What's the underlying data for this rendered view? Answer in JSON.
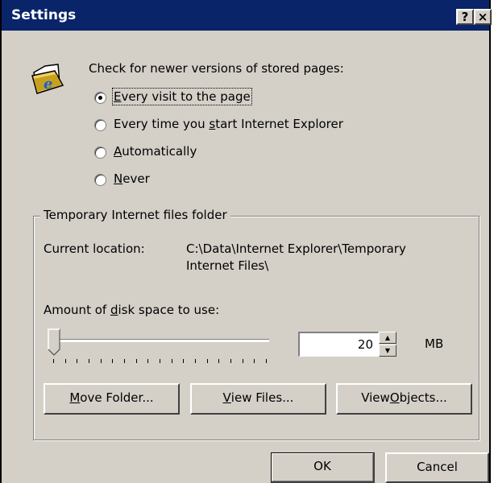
{
  "window": {
    "title": "Settings",
    "help_label": "?",
    "close_label": "×"
  },
  "check": {
    "heading": "Check for newer versions of stored pages:",
    "options": [
      {
        "pre": "",
        "key": "E",
        "post": "very visit to the page",
        "selected": true
      },
      {
        "pre": "Every time you ",
        "key": "s",
        "post": "tart Internet Explorer",
        "selected": false
      },
      {
        "pre": "",
        "key": "A",
        "post": "utomatically",
        "selected": false
      },
      {
        "pre": "",
        "key": "N",
        "post": "ever",
        "selected": false
      }
    ]
  },
  "temp_files": {
    "group_title": "Temporary Internet files folder",
    "location_label": "Current location:",
    "location_line1": "C:\\Data\\Internet Explorer\\Temporary",
    "location_line2": "Internet Files\\",
    "disk_label_pre": "Amount of ",
    "disk_label_key": "d",
    "disk_label_post": "isk space to use:",
    "disk_value": "20",
    "unit": "MB",
    "slider_fraction": 0.0,
    "tick_count": 19
  },
  "buttons": {
    "move": {
      "pre": "",
      "key": "M",
      "post": "ove Folder..."
    },
    "view_files": {
      "pre": "",
      "key": "V",
      "post": "iew Files..."
    },
    "view_objects": {
      "pre": "View ",
      "key": "O",
      "post": "bjects..."
    },
    "ok": "OK",
    "cancel": "Cancel"
  },
  "colors": {
    "titlebar": "#0a246a",
    "face": "#d4d0c8"
  },
  "icons": {
    "folder": "ie-folder-icon"
  }
}
